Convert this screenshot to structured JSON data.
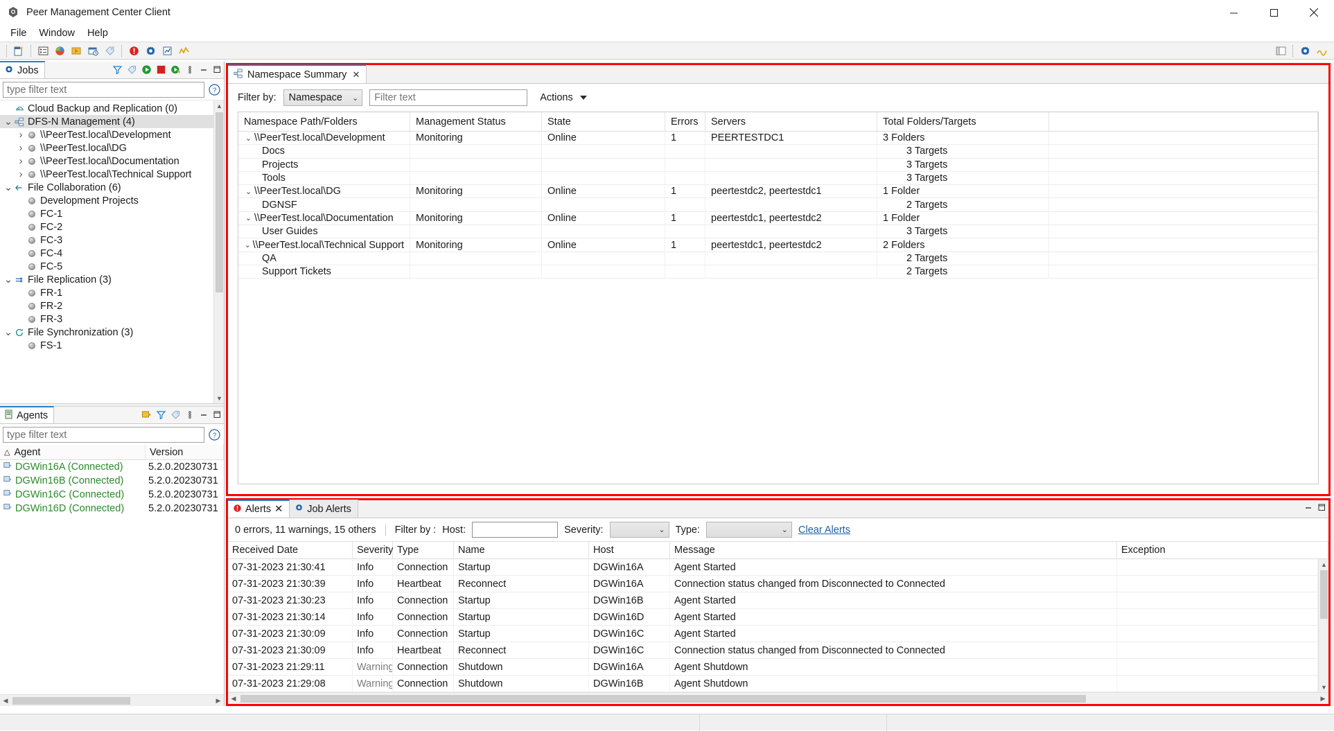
{
  "window": {
    "title": "Peer Management Center Client",
    "app_icon": "peer-app-icon",
    "minimize": "–",
    "maximize": "❐",
    "close": "✕"
  },
  "menubar": {
    "items": [
      "File",
      "Window",
      "Help"
    ]
  },
  "toolbar": {
    "group1": [
      "new-job-icon",
      "list-view-icon",
      "cloud-backup-icon",
      "file-collab-icon",
      "file-replication-icon",
      "tag-icon"
    ],
    "group2": [
      "alerts-icon",
      "preferences-icon",
      "reports-icon",
      "activity-icon"
    ],
    "right": [
      "perspective-icon",
      "settings-perspective-icon",
      "peer-perspective-icon"
    ]
  },
  "jobs_view": {
    "tab_label": "Jobs",
    "tab_icon": "gear-icon",
    "tools": [
      "filter-icon",
      "tag-icon",
      "run-icon",
      "stop-icon",
      "restart-icon",
      "view-menu-icon"
    ],
    "minimize_label": "–",
    "maximize_label": "❐",
    "filter_placeholder": "type filter text",
    "help_label": "?",
    "tree": [
      {
        "label": "Cloud Backup and Replication (0)",
        "level": 1,
        "twist": "",
        "icon": "cloud-icon",
        "selected": false
      },
      {
        "label": "DFS-N Management (4)",
        "level": 1,
        "twist": "⌄",
        "icon": "dfsn-icon",
        "selected": true
      },
      {
        "label": "\\\\PeerTest.local\\Development",
        "level": 2,
        "twist": "›",
        "icon": "job-dot-icon",
        "selected": false
      },
      {
        "label": "\\\\PeerTest.local\\DG",
        "level": 2,
        "twist": "›",
        "icon": "job-dot-icon",
        "selected": false
      },
      {
        "label": "\\\\PeerTest.local\\Documentation",
        "level": 2,
        "twist": "›",
        "icon": "job-dot-icon",
        "selected": false
      },
      {
        "label": "\\\\PeerTest.local\\Technical Support",
        "level": 2,
        "twist": "›",
        "icon": "job-dot-icon",
        "selected": false
      },
      {
        "label": "File Collaboration (6)",
        "level": 1,
        "twist": "⌄",
        "icon": "file-collab-icon",
        "selected": false
      },
      {
        "label": "Development Projects",
        "level": 2,
        "twist": "",
        "icon": "job-dot-icon",
        "selected": false
      },
      {
        "label": "FC-1",
        "level": 2,
        "twist": "",
        "icon": "job-dot-icon",
        "selected": false
      },
      {
        "label": "FC-2",
        "level": 2,
        "twist": "",
        "icon": "job-dot-icon",
        "selected": false
      },
      {
        "label": "FC-3",
        "level": 2,
        "twist": "",
        "icon": "job-dot-icon",
        "selected": false
      },
      {
        "label": "FC-4",
        "level": 2,
        "twist": "",
        "icon": "job-dot-icon",
        "selected": false
      },
      {
        "label": "FC-5",
        "level": 2,
        "twist": "",
        "icon": "job-dot-icon",
        "selected": false
      },
      {
        "label": "File Replication (3)",
        "level": 1,
        "twist": "⌄",
        "icon": "file-replication-icon",
        "selected": false
      },
      {
        "label": "FR-1",
        "level": 2,
        "twist": "",
        "icon": "job-dot-icon",
        "selected": false
      },
      {
        "label": "FR-2",
        "level": 2,
        "twist": "",
        "icon": "job-dot-icon",
        "selected": false
      },
      {
        "label": "FR-3",
        "level": 2,
        "twist": "",
        "icon": "job-dot-icon",
        "selected": false
      },
      {
        "label": "File Synchronization (3)",
        "level": 1,
        "twist": "⌄",
        "icon": "file-sync-icon",
        "selected": false
      },
      {
        "label": "FS-1",
        "level": 2,
        "twist": "",
        "icon": "job-dot-icon",
        "selected": false
      }
    ]
  },
  "agents_view": {
    "tab_label": "Agents",
    "tab_icon": "agent-icon",
    "tools": [
      "agent-tool-icon",
      "filter-icon",
      "tag-icon",
      "view-menu-icon"
    ],
    "minimize_label": "–",
    "maximize_label": "❐",
    "filter_placeholder": "type filter text",
    "help_label": "?",
    "sort_indicator": "△",
    "columns": [
      "Agent",
      "Version"
    ],
    "rows": [
      {
        "agent": "DGWin16A (Connected)",
        "version": "5.2.0.20230731"
      },
      {
        "agent": "DGWin16B (Connected)",
        "version": "5.2.0.20230731"
      },
      {
        "agent": "DGWin16C (Connected)",
        "version": "5.2.0.20230731"
      },
      {
        "agent": "DGWin16D (Connected)",
        "version": "5.2.0.20230731"
      }
    ]
  },
  "editor": {
    "tabs": [
      {
        "label": "Namespace Summary",
        "icon": "dfsn-icon",
        "close": "✕",
        "active": true
      }
    ],
    "minimize_label": "–",
    "maximize_label": "❐",
    "filter_label": "Filter by:",
    "filter_by_value": "Namespace",
    "filter_text_placeholder": "Filter text",
    "actions_label": "Actions",
    "columns": [
      "Namespace Path/Folders",
      "Management Status",
      "State",
      "Errors",
      "Servers",
      "Total Folders/Targets"
    ],
    "rows": [
      {
        "kind": "parent",
        "expander": "⌄",
        "path": "\\\\PeerTest.local\\Development",
        "status": "Monitoring",
        "state": "Online",
        "errors": "1",
        "servers": "PEERTESTDC1",
        "total": "3 Folders"
      },
      {
        "kind": "child",
        "expander": "",
        "path": "Docs",
        "status": "",
        "state": "",
        "errors": "",
        "servers": "",
        "total": "3 Targets"
      },
      {
        "kind": "child",
        "expander": "",
        "path": "Projects",
        "status": "",
        "state": "",
        "errors": "",
        "servers": "",
        "total": "3 Targets"
      },
      {
        "kind": "child",
        "expander": "",
        "path": "Tools",
        "status": "",
        "state": "",
        "errors": "",
        "servers": "",
        "total": "3 Targets"
      },
      {
        "kind": "parent",
        "expander": "⌄",
        "path": "\\\\PeerTest.local\\DG",
        "status": "Monitoring",
        "state": "Online",
        "errors": "1",
        "servers": "peertestdc2, peertestdc1",
        "total": "1 Folder"
      },
      {
        "kind": "child",
        "expander": "",
        "path": "DGNSF",
        "status": "",
        "state": "",
        "errors": "",
        "servers": "",
        "total": "2 Targets"
      },
      {
        "kind": "parent",
        "expander": "⌄",
        "path": "\\\\PeerTest.local\\Documentation",
        "status": "Monitoring",
        "state": "Online",
        "errors": "1",
        "servers": "peertestdc1, peertestdc2",
        "total": "1 Folder"
      },
      {
        "kind": "child",
        "expander": "",
        "path": "User Guides",
        "status": "",
        "state": "",
        "errors": "",
        "servers": "",
        "total": "3 Targets"
      },
      {
        "kind": "parent",
        "expander": "⌄",
        "path": "\\\\PeerTest.local\\Technical Support",
        "status": "Monitoring",
        "state": "Online",
        "errors": "1",
        "servers": "peertestdc1, peertestdc2",
        "total": "2 Folders"
      },
      {
        "kind": "child",
        "expander": "",
        "path": "QA",
        "status": "",
        "state": "",
        "errors": "",
        "servers": "",
        "total": "2 Targets"
      },
      {
        "kind": "child",
        "expander": "",
        "path": "Support Tickets",
        "status": "",
        "state": "",
        "errors": "",
        "servers": "",
        "total": "2 Targets"
      }
    ]
  },
  "alerts_view": {
    "tabs": [
      {
        "label": "Alerts",
        "icon": "alert-icon",
        "close": "✕",
        "active": true
      },
      {
        "label": "Job Alerts",
        "icon": "gear-icon",
        "close": "",
        "active": false
      }
    ],
    "minimize_label": "–",
    "maximize_label": "❐",
    "summary": "0 errors, 11 warnings, 15 others",
    "filter_by_label": "Filter by :",
    "host_label": "Host:",
    "host_value": "",
    "severity_label": "Severity:",
    "severity_value": "",
    "type_label": "Type:",
    "type_value": "",
    "clear_label": "Clear Alerts",
    "columns": [
      "Received Date",
      "Severity",
      "Type",
      "Name",
      "Host",
      "Message",
      "Exception"
    ],
    "rows": [
      {
        "date": "07-31-2023 21:30:41",
        "severity": "Info",
        "type": "Connection",
        "name": "Startup",
        "host": "DGWin16A",
        "message": "Agent Started",
        "exception": ""
      },
      {
        "date": "07-31-2023 21:30:39",
        "severity": "Info",
        "type": "Heartbeat",
        "name": "Reconnect",
        "host": "DGWin16A",
        "message": "Connection status changed from Disconnected to Connected",
        "exception": ""
      },
      {
        "date": "07-31-2023 21:30:23",
        "severity": "Info",
        "type": "Connection",
        "name": "Startup",
        "host": "DGWin16B",
        "message": "Agent Started",
        "exception": ""
      },
      {
        "date": "07-31-2023 21:30:14",
        "severity": "Info",
        "type": "Connection",
        "name": "Startup",
        "host": "DGWin16D",
        "message": "Agent Started",
        "exception": ""
      },
      {
        "date": "07-31-2023 21:30:09",
        "severity": "Info",
        "type": "Connection",
        "name": "Startup",
        "host": "DGWin16C",
        "message": "Agent Started",
        "exception": ""
      },
      {
        "date": "07-31-2023 21:30:09",
        "severity": "Info",
        "type": "Heartbeat",
        "name": "Reconnect",
        "host": "DGWin16C",
        "message": "Connection status changed from Disconnected to Connected",
        "exception": ""
      },
      {
        "date": "07-31-2023 21:29:11",
        "severity": "Warning",
        "type": "Connection",
        "name": "Shutdown",
        "host": "DGWin16A",
        "message": "Agent Shutdown",
        "exception": ""
      },
      {
        "date": "07-31-2023 21:29:08",
        "severity": "Warning",
        "type": "Connection",
        "name": "Shutdown",
        "host": "DGWin16B",
        "message": "Agent Shutdown",
        "exception": ""
      }
    ]
  },
  "colors": {
    "highlight_box": "#ff0000",
    "tab_accent": "#2b7ec1",
    "agent_connected": "#2a8a2a",
    "link": "#1b5fa8",
    "warning_text": "#7d7d7d"
  }
}
